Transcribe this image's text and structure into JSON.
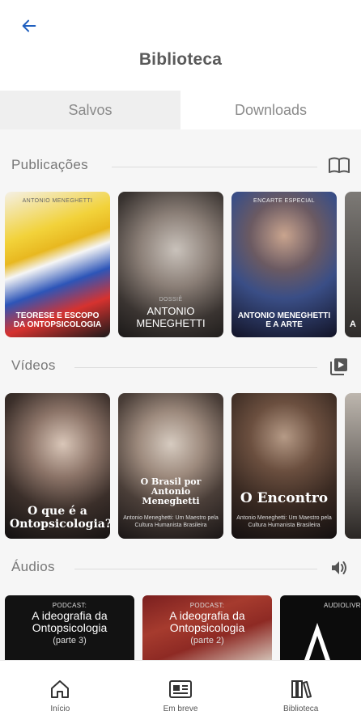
{
  "header": {
    "title": "Biblioteca",
    "back_icon": "arrow-left-icon",
    "accent": "#1f5fbf"
  },
  "tabs": [
    {
      "label": "Salvos",
      "active": true
    },
    {
      "label": "Downloads",
      "active": false
    }
  ],
  "sections": {
    "publicacoes": {
      "title": "Publicações",
      "icon": "open-book-icon",
      "cards": [
        {
          "eyebrow": "Antonio Meneghetti",
          "caption": "TEORESE E ESCOPO DA ONTOPSICOLOGIA"
        },
        {
          "eyebrow": "DOSSIÊ",
          "caption": "ANTONIO MENEGHETTI"
        },
        {
          "eyebrow": "Encarte Especial",
          "caption": "ANTONIO MENEGHETTI E A ARTE"
        },
        {
          "eyebrow": "",
          "caption": "A"
        }
      ]
    },
    "videos": {
      "title": "Vídeos",
      "icon": "video-library-icon",
      "cards": [
        {
          "caption": "O que é a Ontopsicologia?",
          "sub": ""
        },
        {
          "caption": "O Brasil por Antonio Meneghetti",
          "sub": "Antonio Meneghetti: Um Maestro pela Cultura Humanista Brasileira"
        },
        {
          "caption": "O Encontro",
          "sub": "Antonio Meneghetti: Um Maestro pela Cultura Humanista Brasileira"
        },
        {
          "caption": "",
          "sub": ""
        }
      ]
    },
    "audios": {
      "title": "Áudios",
      "icon": "speaker-icon",
      "cards": [
        {
          "eyebrow": "PODCAST:",
          "title": "A ideografia da Ontopsicologia",
          "part": "(parte 3)"
        },
        {
          "eyebrow": "PODCAST:",
          "title": "A ideografia da Ontopsicologia",
          "part": "(parte 2)"
        },
        {
          "eyebrow": "AUDIOLIVR",
          "title": "",
          "part": ""
        }
      ]
    }
  },
  "bottom_nav": [
    {
      "label": "Início",
      "icon": "home-icon"
    },
    {
      "label": "Em breve",
      "icon": "newspaper-icon"
    },
    {
      "label": "Biblioteca",
      "icon": "library-books-icon"
    }
  ]
}
